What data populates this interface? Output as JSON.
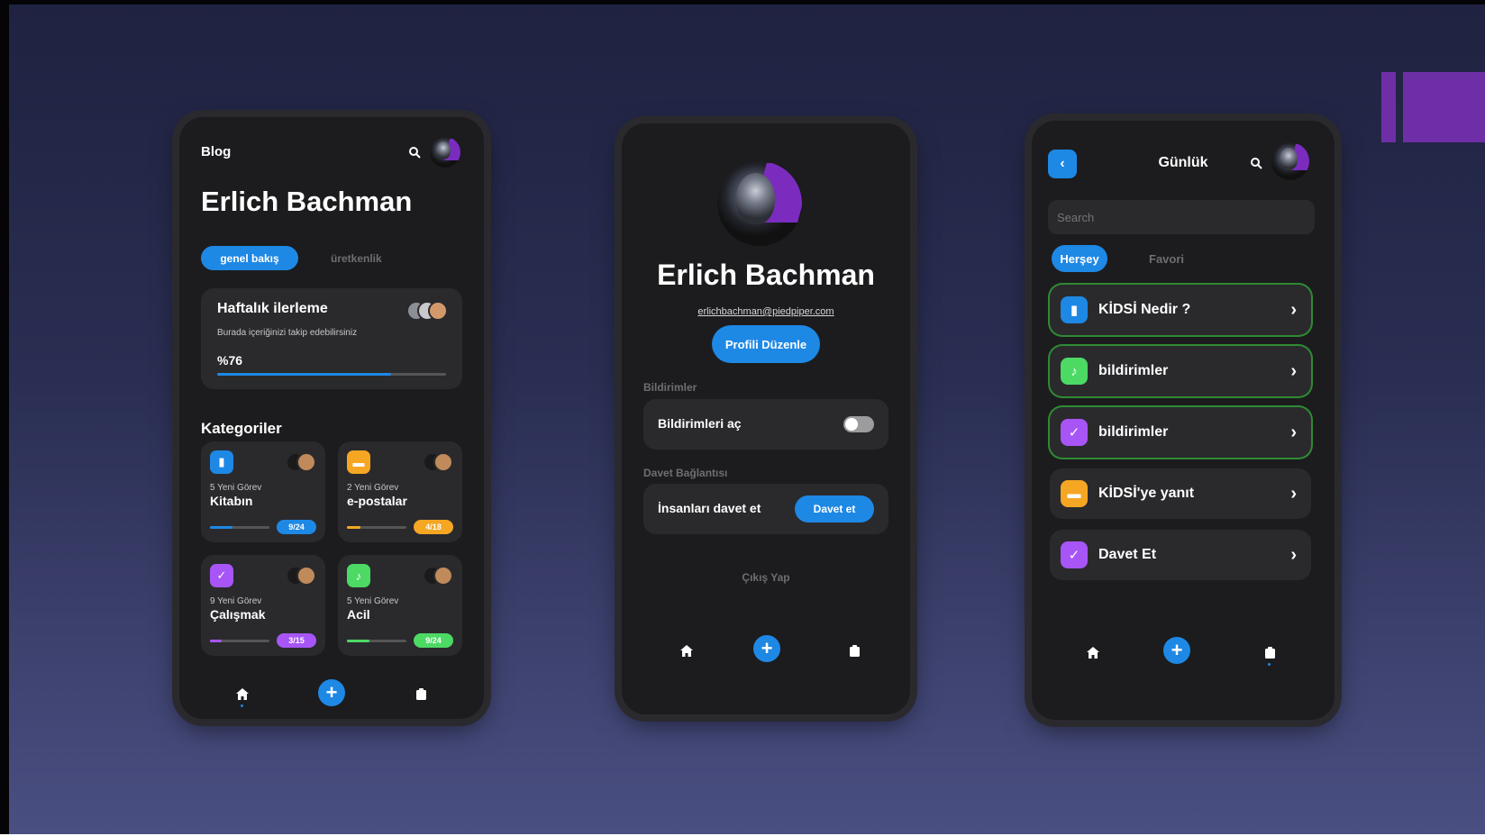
{
  "colors": {
    "accent": "#1e88e5",
    "orange": "#f5a623",
    "purple": "#a855f7",
    "green": "#4cd964",
    "background": "#1c1c1e",
    "card": "#2a2a2d"
  },
  "blog": {
    "title": "Blog",
    "name": "Erlich Bachman",
    "tabs": [
      {
        "label": "genel bakış",
        "active": true
      },
      {
        "label": "üretkenlik",
        "active": false
      }
    ],
    "weekly": {
      "title": "Haftalık ilerleme",
      "subtitle": "Burada içeriğinizi takip edebilirsiniz",
      "percent_label": "%76",
      "progress": 0.76
    },
    "categories_title": "Kategoriler",
    "categories": [
      {
        "tasks": "5 Yeni Görev",
        "name": "Kitabın",
        "badge": "9/24",
        "progress": 0.38,
        "color": "#1e88e5",
        "icon": "book-icon"
      },
      {
        "tasks": "2 Yeni Görev",
        "name": "e-postalar",
        "badge": "4/18",
        "progress": 0.22,
        "color": "#f5a623",
        "icon": "mail-icon"
      },
      {
        "tasks": "9 Yeni Görev",
        "name": "Çalışmak",
        "badge": "3/15",
        "progress": 0.2,
        "color": "#a855f7",
        "icon": "check-icon"
      },
      {
        "tasks": "5 Yeni Görev",
        "name": "Acil",
        "badge": "9/24",
        "progress": 0.38,
        "color": "#4cd964",
        "icon": "bell-icon"
      }
    ]
  },
  "profile": {
    "name": "Erlich Bachman",
    "email": "erlichbachman@piedpiper.com",
    "edit_button": "Profili Düzenle",
    "notifications_section": "Bildirimler",
    "notifications_toggle_label": "Bildirimleri aç",
    "notifications_on": false,
    "invite_section": "Davet Bağlantısı",
    "invite_label": "İnsanları davet et",
    "invite_button": "Davet et",
    "logout": "Çıkış Yap"
  },
  "journal": {
    "title": "Günlük",
    "search_placeholder": "Search",
    "tabs": [
      {
        "label": "Herşey",
        "active": true
      },
      {
        "label": "Favori",
        "active": false
      }
    ],
    "items": [
      {
        "label": "KİDSİ Nedir ?",
        "color": "#1e88e5",
        "icon": "book-icon",
        "highlighted": true
      },
      {
        "label": "bildirimler",
        "color": "#4cd964",
        "icon": "bell-icon",
        "highlighted": true
      },
      {
        "label": "bildirimler",
        "color": "#a855f7",
        "icon": "check-icon",
        "highlighted": true
      },
      {
        "label": "KİDSİ'ye yanıt",
        "color": "#f5a623",
        "icon": "mail-icon",
        "highlighted": false
      },
      {
        "label": "Davet Et",
        "color": "#a855f7",
        "icon": "check-icon",
        "highlighted": false
      }
    ]
  },
  "nav": {
    "home_icon": "home-icon",
    "add_icon": "plus-icon",
    "clipboard_icon": "clipboard-icon"
  }
}
